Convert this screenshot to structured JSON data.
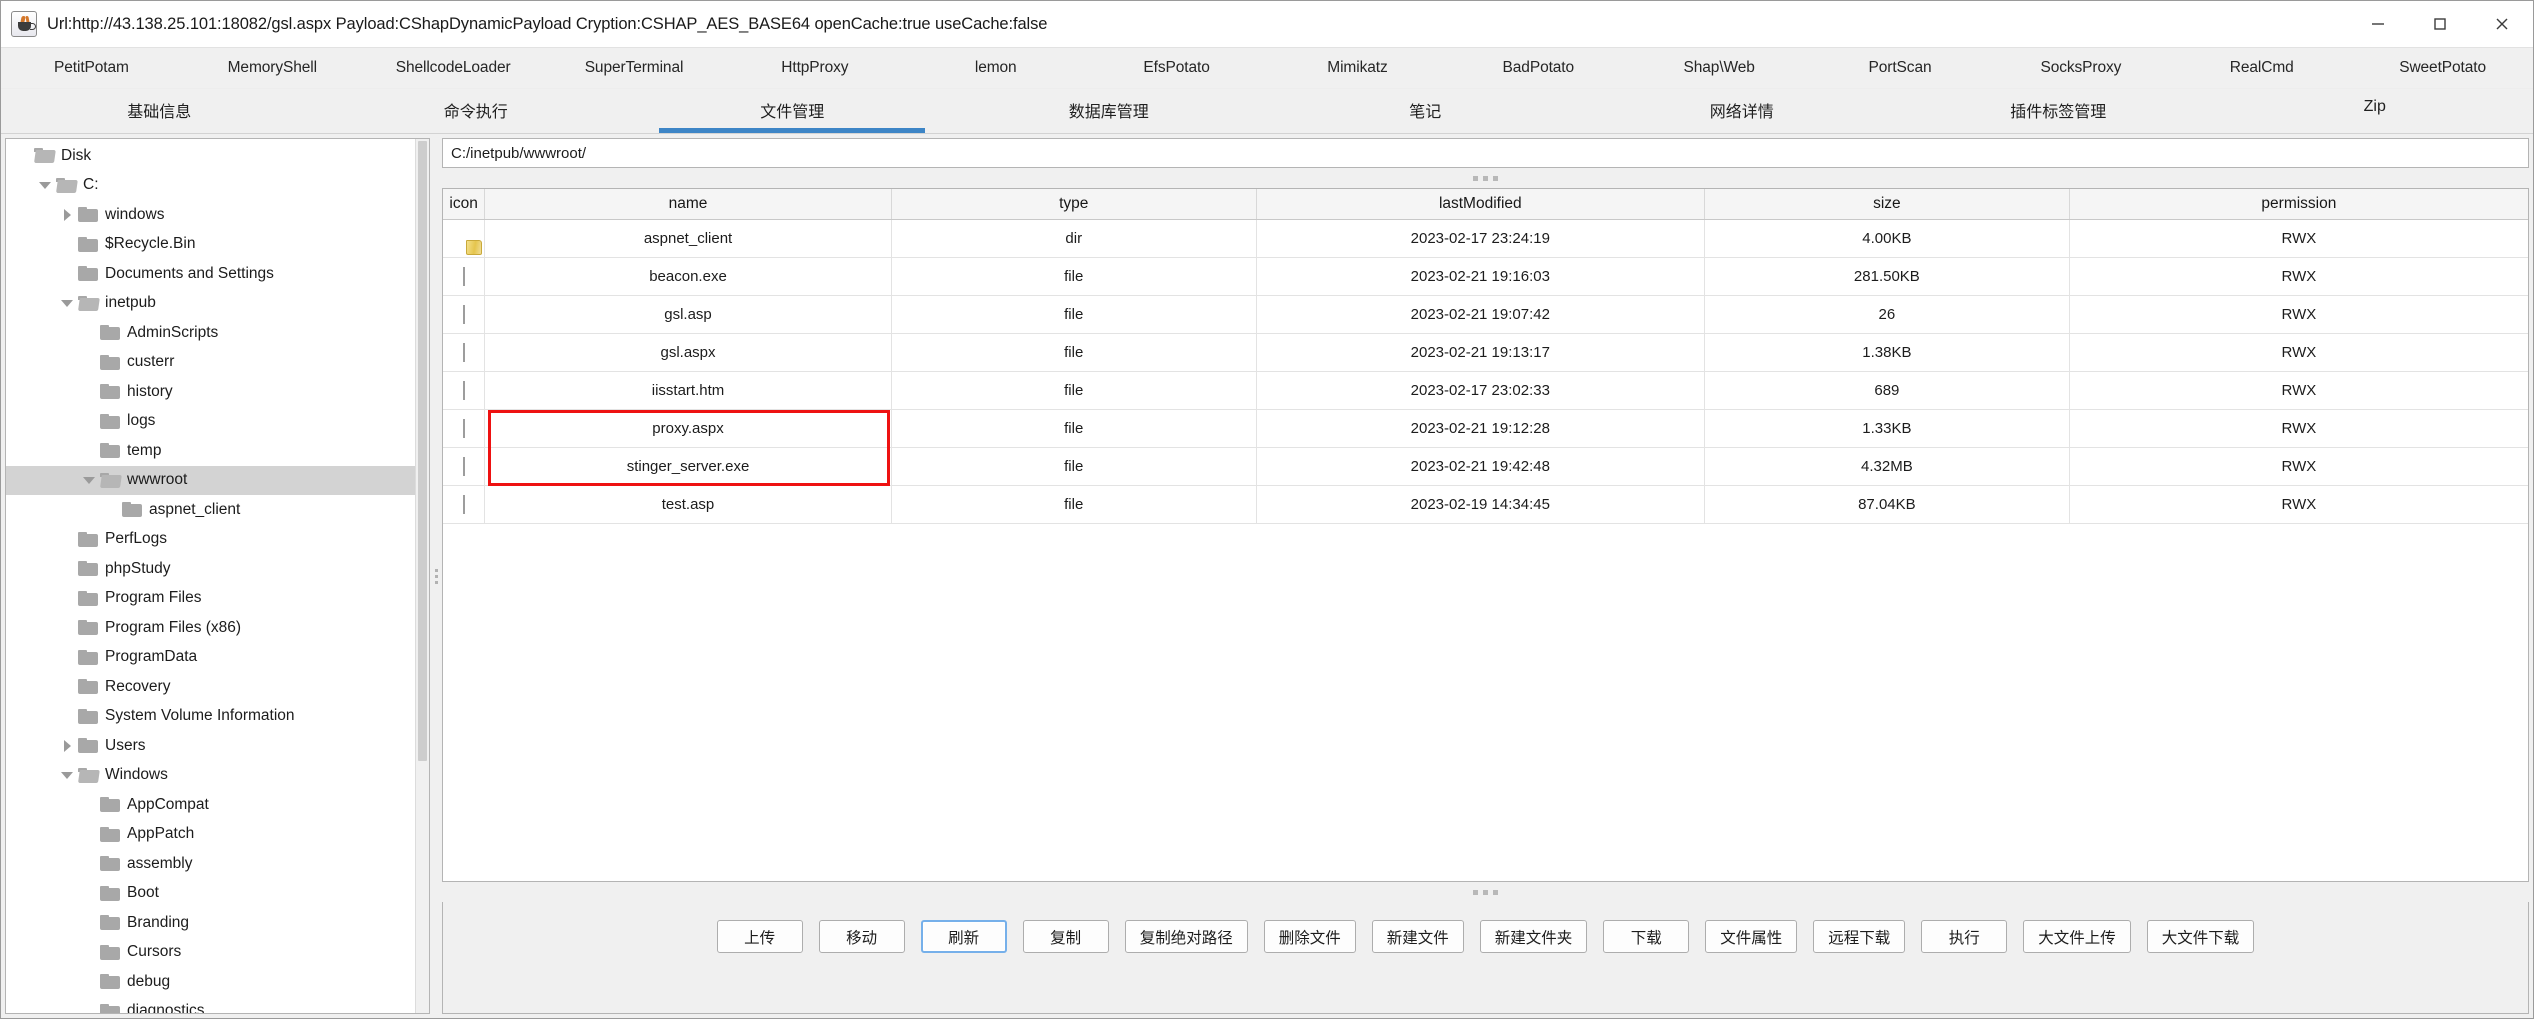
{
  "window": {
    "title": "Url:http://43.138.25.101:18082/gsl.aspx Payload:CShapDynamicPayload Cryption:CSHAP_AES_BASE64 openCache:true useCache:false",
    "app_icon": "java-coffee-cup-icon",
    "controls": {
      "minimize": "minimize-icon",
      "maximize": "maximize-icon",
      "close": "close-icon"
    }
  },
  "plugin_tabs": [
    {
      "label": "PetitPotam"
    },
    {
      "label": "MemoryShell"
    },
    {
      "label": "ShellcodeLoader"
    },
    {
      "label": "SuperTerminal"
    },
    {
      "label": "HttpProxy"
    },
    {
      "label": "lemon"
    },
    {
      "label": "EfsPotato"
    },
    {
      "label": "Mimikatz"
    },
    {
      "label": "BadPotato"
    },
    {
      "label": "Shap\\Web"
    },
    {
      "label": "PortScan"
    },
    {
      "label": "SocksProxy"
    },
    {
      "label": "RealCmd"
    },
    {
      "label": "SweetPotato"
    }
  ],
  "main_tabs": [
    {
      "label": "基础信息",
      "active": false
    },
    {
      "label": "命令执行",
      "active": false
    },
    {
      "label": "文件管理",
      "active": true
    },
    {
      "label": "数据库管理",
      "active": false
    },
    {
      "label": "笔记",
      "active": false
    },
    {
      "label": "网络详情",
      "active": false
    },
    {
      "label": "插件标签管理",
      "active": false
    },
    {
      "label": "Zip",
      "active": false
    }
  ],
  "accent_color": "#3d85c6",
  "highlight_color": "#ee1111",
  "tree": {
    "items": [
      {
        "label": "Disk",
        "depth": 0,
        "twisty": "none",
        "icon": "folder-open-icon",
        "selected": false
      },
      {
        "label": "C:",
        "depth": 1,
        "twisty": "down",
        "icon": "folder-open-icon",
        "selected": false
      },
      {
        "label": "windows",
        "depth": 2,
        "twisty": "right",
        "icon": "folder-icon",
        "selected": false
      },
      {
        "label": "$Recycle.Bin",
        "depth": 2,
        "twisty": "none",
        "icon": "folder-icon",
        "selected": false
      },
      {
        "label": "Documents and Settings",
        "depth": 2,
        "twisty": "none",
        "icon": "folder-icon",
        "selected": false
      },
      {
        "label": "inetpub",
        "depth": 2,
        "twisty": "down",
        "icon": "folder-open-icon",
        "selected": false
      },
      {
        "label": "AdminScripts",
        "depth": 3,
        "twisty": "none",
        "icon": "folder-icon",
        "selected": false
      },
      {
        "label": "custerr",
        "depth": 3,
        "twisty": "none",
        "icon": "folder-icon",
        "selected": false
      },
      {
        "label": "history",
        "depth": 3,
        "twisty": "none",
        "icon": "folder-icon",
        "selected": false
      },
      {
        "label": "logs",
        "depth": 3,
        "twisty": "none",
        "icon": "folder-icon",
        "selected": false
      },
      {
        "label": "temp",
        "depth": 3,
        "twisty": "none",
        "icon": "folder-icon",
        "selected": false
      },
      {
        "label": "wwwroot",
        "depth": 3,
        "twisty": "down",
        "icon": "folder-open-icon",
        "selected": true
      },
      {
        "label": "aspnet_client",
        "depth": 4,
        "twisty": "none",
        "icon": "folder-icon",
        "selected": false
      },
      {
        "label": "PerfLogs",
        "depth": 2,
        "twisty": "none",
        "icon": "folder-icon",
        "selected": false
      },
      {
        "label": "phpStudy",
        "depth": 2,
        "twisty": "none",
        "icon": "folder-icon",
        "selected": false
      },
      {
        "label": "Program Files",
        "depth": 2,
        "twisty": "none",
        "icon": "folder-icon",
        "selected": false
      },
      {
        "label": "Program Files (x86)",
        "depth": 2,
        "twisty": "none",
        "icon": "folder-icon",
        "selected": false
      },
      {
        "label": "ProgramData",
        "depth": 2,
        "twisty": "none",
        "icon": "folder-icon",
        "selected": false
      },
      {
        "label": "Recovery",
        "depth": 2,
        "twisty": "none",
        "icon": "folder-icon",
        "selected": false
      },
      {
        "label": "System Volume Information",
        "depth": 2,
        "twisty": "none",
        "icon": "folder-icon",
        "selected": false
      },
      {
        "label": "Users",
        "depth": 2,
        "twisty": "right",
        "icon": "folder-icon",
        "selected": false
      },
      {
        "label": "Windows",
        "depth": 2,
        "twisty": "down",
        "icon": "folder-open-icon",
        "selected": false
      },
      {
        "label": "AppCompat",
        "depth": 3,
        "twisty": "none",
        "icon": "folder-icon",
        "selected": false
      },
      {
        "label": "AppPatch",
        "depth": 3,
        "twisty": "none",
        "icon": "folder-icon",
        "selected": false
      },
      {
        "label": "assembly",
        "depth": 3,
        "twisty": "none",
        "icon": "folder-icon",
        "selected": false
      },
      {
        "label": "Boot",
        "depth": 3,
        "twisty": "none",
        "icon": "folder-icon",
        "selected": false
      },
      {
        "label": "Branding",
        "depth": 3,
        "twisty": "none",
        "icon": "folder-icon",
        "selected": false
      },
      {
        "label": "Cursors",
        "depth": 3,
        "twisty": "none",
        "icon": "folder-icon",
        "selected": false
      },
      {
        "label": "debug",
        "depth": 3,
        "twisty": "none",
        "icon": "folder-icon",
        "selected": false
      },
      {
        "label": "diagnostics",
        "depth": 3,
        "twisty": "none",
        "icon": "folder-icon",
        "selected": false
      }
    ]
  },
  "path_bar": {
    "value": "C:/inetpub/wwwroot/"
  },
  "file_table": {
    "columns": [
      "icon",
      "name",
      "type",
      "lastModified",
      "size",
      "permission"
    ],
    "rows": [
      {
        "icon": "folder-icon",
        "name": "aspnet_client",
        "type": "dir",
        "lastModified": "2023-02-17 23:24:19",
        "size": "4.00KB",
        "permission": "RWX"
      },
      {
        "icon": "file-icon",
        "name": "beacon.exe",
        "type": "file",
        "lastModified": "2023-02-21 19:16:03",
        "size": "281.50KB",
        "permission": "RWX"
      },
      {
        "icon": "file-icon",
        "name": "gsl.asp",
        "type": "file",
        "lastModified": "2023-02-21 19:07:42",
        "size": "26",
        "permission": "RWX"
      },
      {
        "icon": "file-icon",
        "name": "gsl.aspx",
        "type": "file",
        "lastModified": "2023-02-21 19:13:17",
        "size": "1.38KB",
        "permission": "RWX"
      },
      {
        "icon": "file-icon",
        "name": "iisstart.htm",
        "type": "file",
        "lastModified": "2023-02-17 23:02:33",
        "size": "689",
        "permission": "RWX"
      },
      {
        "icon": "file-icon",
        "name": "proxy.aspx",
        "type": "file",
        "lastModified": "2023-02-21 19:12:28",
        "size": "1.33KB",
        "permission": "RWX"
      },
      {
        "icon": "file-icon",
        "name": "stinger_server.exe",
        "type": "file",
        "lastModified": "2023-02-21 19:42:48",
        "size": "4.32MB",
        "permission": "RWX"
      },
      {
        "icon": "file-icon",
        "name": "test.asp",
        "type": "file",
        "lastModified": "2023-02-19 14:34:45",
        "size": "87.04KB",
        "permission": "RWX"
      }
    ]
  },
  "buttons": [
    {
      "label": "上传",
      "focused": false
    },
    {
      "label": "移动",
      "focused": false
    },
    {
      "label": "刷新",
      "focused": true
    },
    {
      "label": "复制",
      "focused": false
    },
    {
      "label": "复制绝对路径",
      "focused": false
    },
    {
      "label": "删除文件",
      "focused": false
    },
    {
      "label": "新建文件",
      "focused": false
    },
    {
      "label": "新建文件夹",
      "focused": false
    },
    {
      "label": "下载",
      "focused": false
    },
    {
      "label": "文件属性",
      "focused": false
    },
    {
      "label": "远程下载",
      "focused": false
    },
    {
      "label": "执行",
      "focused": false
    },
    {
      "label": "大文件上传",
      "focused": false
    },
    {
      "label": "大文件下载",
      "focused": false
    }
  ]
}
